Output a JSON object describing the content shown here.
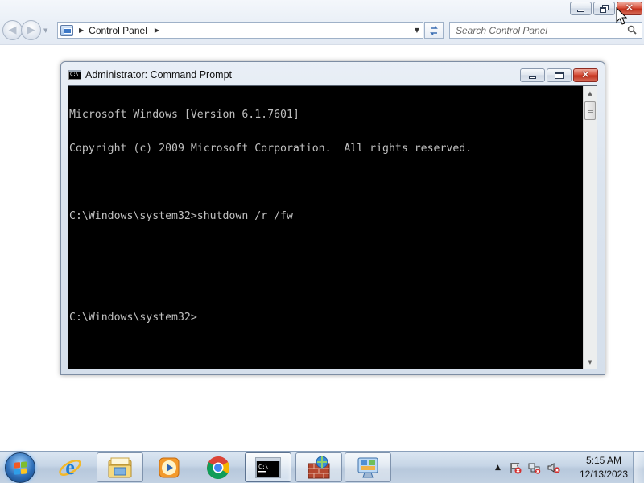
{
  "explorer": {
    "address_segment": "Control Panel",
    "search_placeholder": "Search Control Panel"
  },
  "cmd": {
    "title": "Administrator: Command Prompt",
    "lines": [
      "Microsoft Windows [Version 6.1.7601]",
      "Copyright (c) 2009 Microsoft Corporation.  All rights reserved.",
      "",
      "C:\\Windows\\system32>shutdown /r /fw",
      "",
      "",
      "C:\\Windows\\system32>"
    ]
  },
  "taskbar": {
    "pinned": [
      "start-orb",
      "internet-explorer-icon",
      "windows-explorer-icon",
      "windows-media-player-icon",
      "chrome-icon",
      "command-prompt-icon",
      "firewall-icon",
      "control-panel-icon"
    ],
    "time": "5:15 AM",
    "date": "12/13/2023"
  },
  "colors": {
    "console_bg": "#000000",
    "console_text": "#c0c0c0",
    "close_red": "#c7321d"
  }
}
